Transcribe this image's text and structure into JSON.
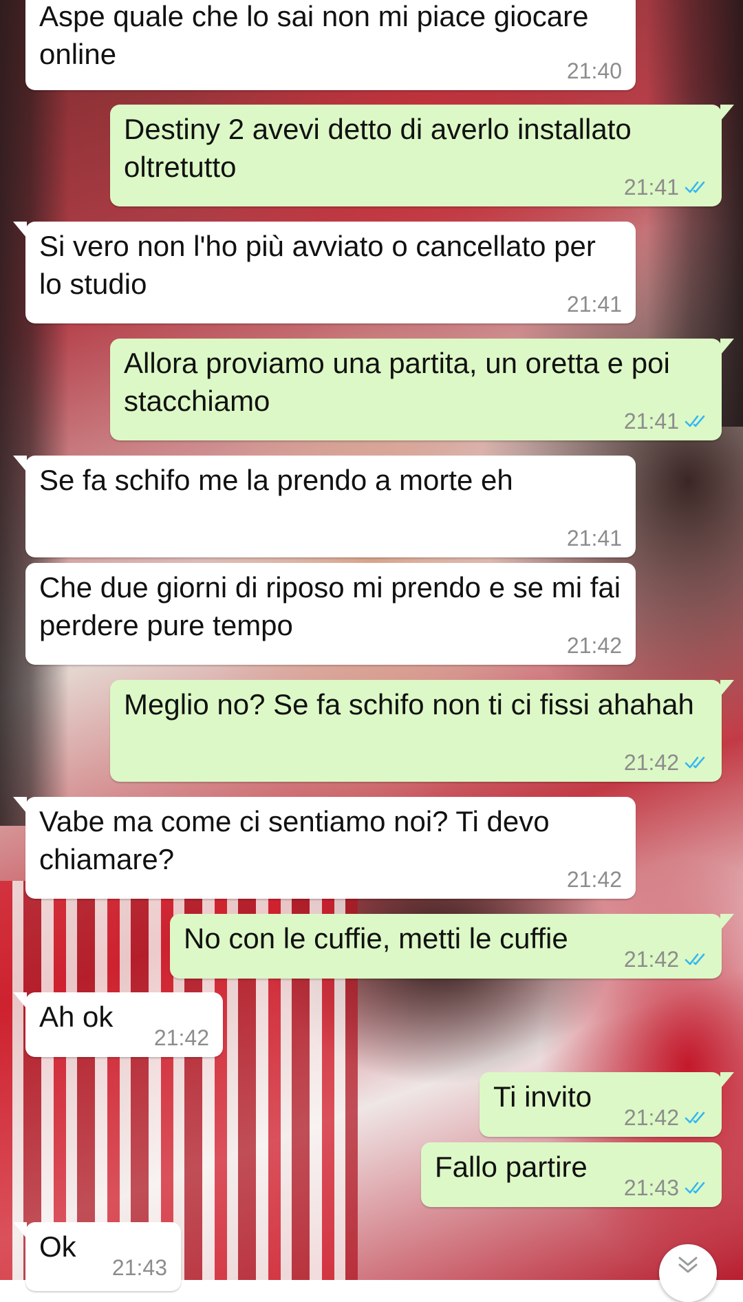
{
  "colors": {
    "incoming_bubble": "#ffffff",
    "outgoing_bubble": "#dcf8c6",
    "timestamp": "#8c8c8c",
    "read_ticks": "#34b7f1"
  },
  "messages": [
    {
      "direction": "in",
      "text": "Aspe quale che lo sai non mi piace giocare online",
      "time": "21:40"
    },
    {
      "direction": "out",
      "text": "Destiny 2 avevi detto di averlo installato oltretutto",
      "time": "21:41",
      "status": "read"
    },
    {
      "direction": "in",
      "text": "Si vero non l'ho più avviato o cancellato per lo studio",
      "time": "21:41"
    },
    {
      "direction": "out",
      "text": "Allora proviamo una partita, un oretta e poi stacchiamo",
      "time": "21:41",
      "status": "read"
    },
    {
      "direction": "in",
      "text": "Se fa schifo me la prendo a morte eh",
      "time": "21:41"
    },
    {
      "direction": "in",
      "text": "Che due giorni di riposo mi prendo e se mi fai perdere pure tempo",
      "time": "21:42"
    },
    {
      "direction": "out",
      "text": "Meglio no? Se fa schifo non ti ci fissi ahahah",
      "time": "21:42",
      "status": "read"
    },
    {
      "direction": "in",
      "text": "Vabe ma come ci sentiamo noi? Ti devo chiamare?",
      "time": "21:42"
    },
    {
      "direction": "out",
      "text": "No con le cuffie, metti le cuffie",
      "time": "21:42",
      "status": "read"
    },
    {
      "direction": "in",
      "text": "Ah ok",
      "time": "21:42"
    },
    {
      "direction": "out",
      "text": "Ti invito",
      "time": "21:42",
      "status": "read"
    },
    {
      "direction": "out",
      "text": "Fallo partire",
      "time": "21:43",
      "status": "read"
    },
    {
      "direction": "in",
      "text": "Ok",
      "time": "21:43"
    }
  ],
  "icons": {
    "read_receipt": "double-check-icon",
    "scroll_down": "chevron-down-icon"
  }
}
